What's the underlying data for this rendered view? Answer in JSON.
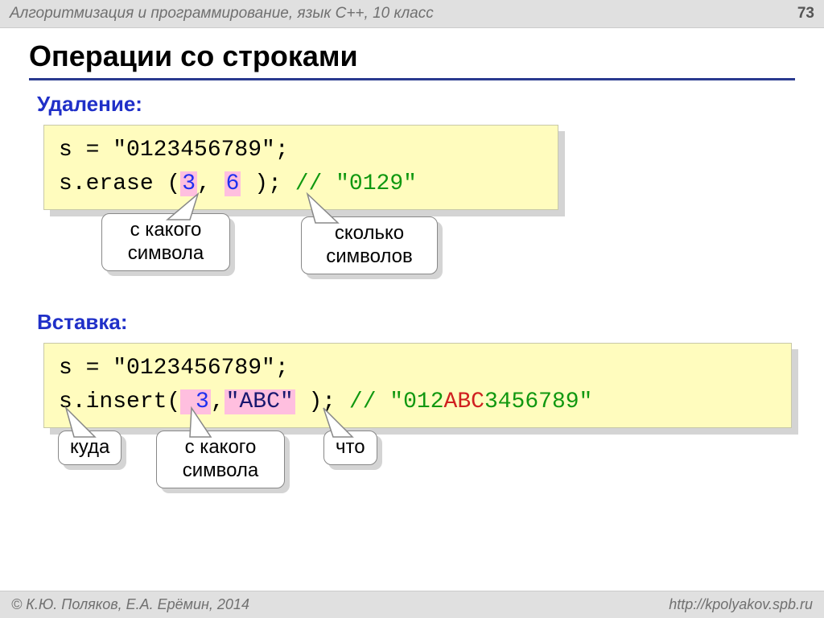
{
  "header": {
    "course": "Алгоритмизация и программирование, язык C++, 10 класс",
    "page": "73"
  },
  "title": "Операции со строками",
  "section1": {
    "heading": "Удаление:",
    "line1": "s = \"0123456789\";",
    "line2_a": "s.erase (",
    "line2_b": "3",
    "line2_c": ", ",
    "line2_d": "6",
    "line2_e": " );",
    "comment": " // \"0129\"",
    "callouts": {
      "fromWhich": "с какого символа",
      "howMany": "сколько символов"
    }
  },
  "section2": {
    "heading": "Вставка:",
    "line1": "s = \"0123456789\";",
    "line2_a": "s.insert(",
    "line2_b": " 3",
    "line2_c": ",",
    "line2_d": "\"ABC\"",
    "line2_e": " );",
    "comment_a": " // \"012",
    "comment_b": "ABC",
    "comment_c": "3456789\"",
    "callouts": {
      "where": "куда",
      "fromWhich": "с какого символа",
      "what": "что"
    }
  },
  "footer": {
    "authors": "© К.Ю. Поляков, Е.А. Ерёмин, 2014",
    "url": "http://kpolyakov.spb.ru"
  }
}
